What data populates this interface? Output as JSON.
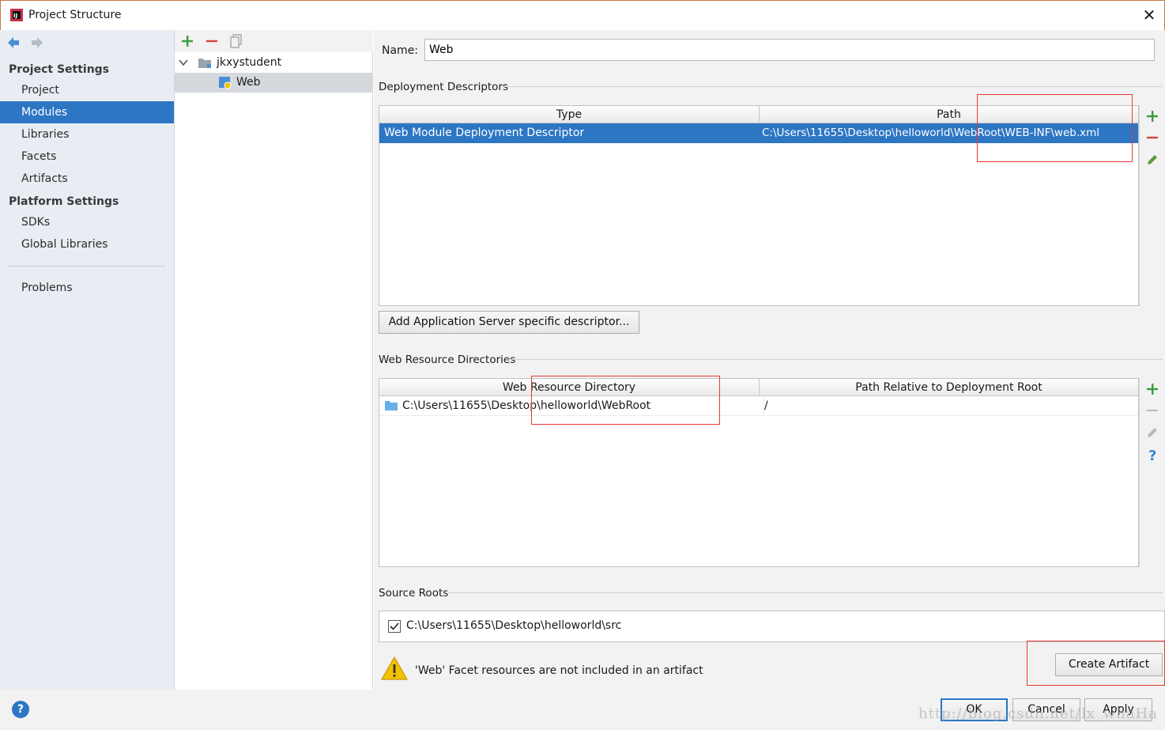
{
  "window": {
    "title": "Project Structure",
    "close_glyph": "✕"
  },
  "nav": {
    "project_settings_header": "Project Settings",
    "platform_settings_header": "Platform Settings",
    "items": [
      {
        "label": "Project"
      },
      {
        "label": "Modules"
      },
      {
        "label": "Libraries"
      },
      {
        "label": "Facets"
      },
      {
        "label": "Artifacts"
      },
      {
        "label": "SDKs"
      },
      {
        "label": "Global Libraries"
      },
      {
        "label": "Problems"
      }
    ],
    "selected": "Modules"
  },
  "tree": {
    "root": {
      "label": "jkxystudent",
      "expanded": true
    },
    "child": {
      "label": "Web",
      "selected": true
    }
  },
  "form": {
    "name_label": "Name:",
    "name_value": "Web"
  },
  "deployment": {
    "section_title": "Deployment Descriptors",
    "columns": [
      "Type",
      "Path"
    ],
    "rows": [
      {
        "type": "Web Module Deployment Descriptor",
        "path": "C:\\Users\\11655\\Desktop\\helloworld\\WebRoot\\WEB-INF\\web.xml"
      }
    ],
    "add_button": "Add Application Server specific descriptor..."
  },
  "web_resources": {
    "section_title": "Web Resource Directories",
    "columns": [
      "Web Resource Directory",
      "Path Relative to Deployment Root"
    ],
    "rows": [
      {
        "dir": "C:\\Users\\11655\\Desktop\\helloworld\\WebRoot",
        "rel": "/"
      }
    ]
  },
  "source_roots": {
    "section_title": "Source Roots",
    "items": [
      {
        "path": "C:\\Users\\11655\\Desktop\\helloworld\\src",
        "checked": true
      }
    ]
  },
  "warning": {
    "text": "'Web' Facet resources are not included in an artifact",
    "button": "Create Artifact"
  },
  "footer": {
    "ok": "OK",
    "cancel": "Cancel",
    "apply": "Apply",
    "help": "?",
    "watermark": "http://blog.csdn.net/lx_whaHa"
  },
  "colors": {
    "selection": "#2d76c4",
    "add_green": "#3d9a3d",
    "remove_red": "#d9423b",
    "annotation_red": "#e53935",
    "warning_yellow": "#f2c200"
  },
  "icons": [
    "back-arrow-icon",
    "forward-arrow-icon",
    "add-icon",
    "remove-icon",
    "copy-icon",
    "folder-icon",
    "web-module-icon",
    "edit-icon",
    "help-icon",
    "warning-icon",
    "checkbox-icon"
  ]
}
